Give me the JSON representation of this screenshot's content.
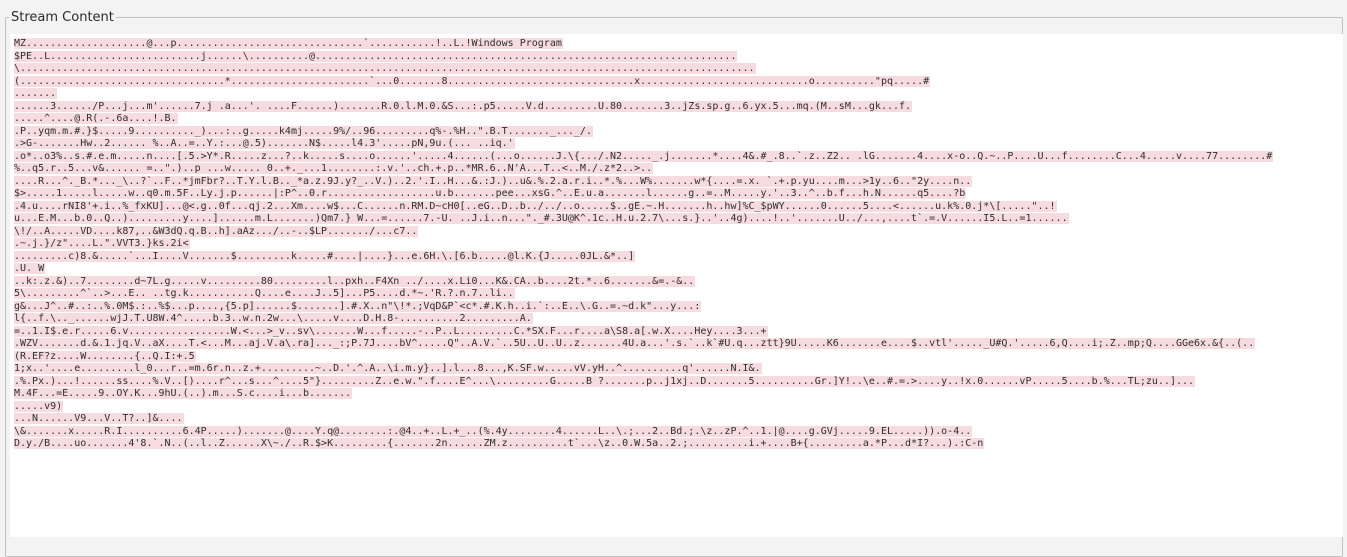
{
  "panel": {
    "title": "Stream Content"
  },
  "colors": {
    "highlight": "#f6dbe0",
    "background": "#ffffff",
    "text": "#303030"
  },
  "stream": {
    "lines": [
      "MZ....................@...p...............................`...........!..L.!Windows Program",
      "$PE..L.........................j......\\..........@......................................................................",
      "\\..........................................................................................................................",
      "(..................................*.......................`...0.......8...............................x............................o..........\"pq.....#",
      ".......",
      "......3....../P...j...m'......7.j .a...'. ....F......).......R.0.l.M.0.&S...:.p5.....V.d.........U.80.......3..jZs.sp.g..6.yx.5...mq.(M..sM...gk...f.",
      ".....^....@.R(.-.6a....!.B.",
      ".P..yqm.m.#.}$.....9.........._)...:..g.....k4mj.....9%/..96.........q%-.%H..\".B.T......._..._/.",
      ".>G-.......Hw..2...... %..A..=..Y.:...@.5).......N$.....l4.3'.....pN,9u.(... ..iq.'",
      ".o*..o3%..s.#.e.m.....n....[.5.>Y*.R.....z...?..k.....s....o......'.....4......(...o......J.\\{.../.N2....._.j.......*....4&.#_.8..`.z..Z2.. .lG.......4....x-o..Q.~..P....U...f........C...4.....v....77........#",
      "%..q5.r..5...v&...... =..\".)..p ...w..... 0..+._...1........:.v.'..ch.+.p..*MR.6..N'A...T..<..M./.z*2..>..",
      "....R...^._B.*..._\\..?`..F..*jmFbr?..T.Y.l.B.._*a.z.9J.y?_..V.)..2.'.I..H...&.:J.)..u&.%.2.a.r.i..*.%...W%.......w*{....=.x. `.+.p.yu....m...>1y..6..\"2y....n..",
      "$>.....1.....l.....w..q0.m.5F..Ly.j.p......|:P^..0.r..................u.b.......pee...xsG.^..E.u.a.......l......g..=..M.....y.'..3..^..b.f...h.N......q5....?b",
      ".4.u....rNI8'+.i..%_fxKU]...@<.g..0f...qj.2...Xm....w$...C......n.RM.D~cH0[..eG..D..b../../..o.....$..gE.~.H.......h..hw]%C_$pWY......0......5....<......u.k%.0.j*\\[.....\"..!",
      "u...E.M...b.0..Q..).........y....]......m.L.......)Qm7.} W...=......7.-U. ..J.i..n...\"._#.3U@K^.1c..H.u.2.7\\...s.}..'..4g)....!..'.......U../...,....t`.=.V......I5.L..=1......",
      "\\!/..A.....VD....k87,..&W3dQ.q.B..h].aAz.../..-..$LP......./...c7..",
      ".~.j.}/z\"....L.\".VVT3.}ks.2i<",
      ".........c)8.&.....`...I....V.......$.........k.....#....|....}...e.6H.\\.[6.b.....@l.K.{J.....0JL.&*..]",
      ".U. W",
      "..k:.z.&)..7........d~7L.g.....v.........80.........l..pxh..F4Xn ../....x.Li0...K&.CA..b....2t.*..6.......&=.-&..",
      "5\\.........^`..>...E.. ..tg.k...........Q....e....J..5]...P5....d.*~.'R.?.n.7..li..",
      "g&...J^..#..:..%.0M$.:..%$...p....,{5.p]......$.......].#.X..n\"\\!*.;VqD&P`<c*.#.K.h..i.`:..E..\\.G..=.~d.k\"...y...:",
      "l{..f.\\.._......wjJ.T.U8W.4^.....b.3..w.n.2w...\\.....v....D.H.8-..........2.........A.",
      "=..1.I$.e.r.....6.v.................W.<...>_v..sv\\.......W...f.....-..P..L.........C.*SX.F...r....a\\S8.a[.w.X....Hey....3...+",
      ".WZV.......d.&.1.jq.V..aX....T.<...M...aj.V.a\\.ra]..._:;P.7J....bV^.....Q\"..A.V.`..5U..U..U..z.......4U.a...'.s.`..k`#U.q...ztt}9U.....K6.......e....$..vtl'....._U#Q.'.....6,Q....i;.Z..mp;Q....GGe6x.&{..(..",
      "(R.EF?z....W........{..Q.I:+.5",
      "1;x..'....e.........l_0...r..=m.6r.n..z.+.........~..D.'.^.A..\\i.m.y}..].l...8...,K.SF.w.....vV.yH..^..........q'......N.I&.",
      ".%.Px.)...!......ss....%.V..[)....r^...s...^....5\"}.........Z..e.w.\".f....E^...\\.........G.....B ?.......p..j1xj..D.......5..........Gr.]Y!..\\e..#.=.>....y..!x.0......vP.....5....b.%...TL;zu..]...",
      "M.4F...=E.....9..OY.K...9hU.(..).m...S.c....i...b.......",
      ".....v9)",
      "...N......V9...V..T?..]&....",
      "\\&.......x.....R.I..........6.4P.....).......@....Y.q@........:.@4..+..L.+_..(%.4y........4......L..\\.;...2..Bd.;.\\z..zP.^..1.|@....g.GVj.....9.EL.....)).o-4..",
      "D.y./B....uo.......4'8.`.N..(..l..Z......X\\~./..R.$>K.........{.......2n......ZM.z..........t`...\\z..0.W.5a..2.;..........i.+....B+{.........a.*P...d*I?...).:C-n"
    ]
  }
}
